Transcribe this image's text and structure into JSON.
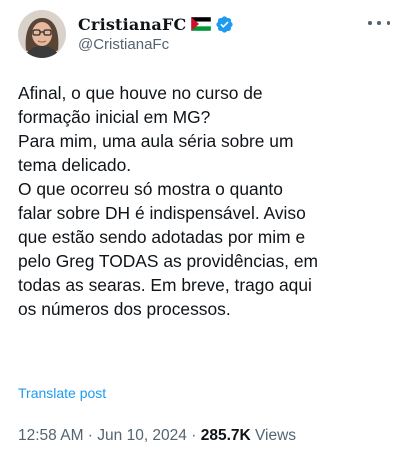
{
  "author": {
    "display_name": "𝐂𝐫𝐢𝐬𝐭𝐢𝐚𝐧𝐚𝐅𝐂",
    "handle": "@CristianaFc",
    "flag_icon": "palestine-flag-icon",
    "verified_icon": "verified-badge-icon",
    "verified_color": "#1d9bf0"
  },
  "menu": {
    "icon": "more-horizontal-icon"
  },
  "tweet": {
    "text": "Afinal, o que houve no curso de\nformação inicial em MG?\nPara mim, uma aula séria sobre um\ntema delicado.\nO que ocorreu só mostra o quanto\nfalar sobre DH é indispensável. Aviso\nque estão sendo adotadas por mim e\npelo Greg TODAS as providências, em\ntodas as searas. Em breve, trago aqui\nos números dos processos.",
    "translate_label": "Translate post"
  },
  "meta": {
    "time": "12:58 AM",
    "separator": " · ",
    "date": "Jun 10, 2024",
    "views_count": "285.7K",
    "views_label": " Views"
  },
  "colors": {
    "text": "#0f1419",
    "secondary": "#536471",
    "link": "#1d9bf0"
  }
}
